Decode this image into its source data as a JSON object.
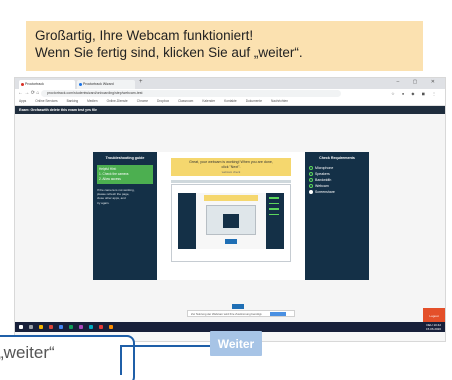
{
  "callout": {
    "line1": "Großartig, Ihre Webcam funktioniert!",
    "line2": "Wenn Sie fertig sind, klicken Sie auf „weiter“."
  },
  "browser": {
    "tab1": "Proctortrack",
    "tab2": "Proctortrack Wizard",
    "new_tab": "+",
    "window_controls": "– ▢ ✕",
    "url": "proctortrack.com/studentwizard/onboarding/step/webcam-test",
    "nav_icons": "← → ⟳ ⌂",
    "ext_icons": "☆ ● ◆ ◼ ⋮",
    "bookmarks": [
      "Apps",
      "Online Services",
      "Banking",
      "Medien",
      "Online-Dienste",
      "Chrome",
      "Dropbox",
      "Classroom",
      "Kalender",
      "Kontakte",
      "Dokumente",
      "Nachrichten"
    ]
  },
  "exam": {
    "bar_text": "Exam: Grofaswith delete this exam test yes file",
    "left_panel": {
      "title": "Troubleshooting guide",
      "green_lines": [
        "Helpful Hint:",
        "1. Check the camera",
        "2. Allow access"
      ],
      "text_lines": [
        "If the camera is not working,",
        "please refresh the page,",
        "close other apps, and",
        "try again."
      ]
    },
    "center": {
      "prompt": "Great, your webcam is working! When you are done,",
      "prompt2": "click \"Next\".",
      "sub": "webcam check"
    },
    "right_panel": {
      "title": "Check Requirements",
      "items": [
        {
          "label": "Microphone",
          "done": true
        },
        {
          "label": "Speakers",
          "done": true
        },
        {
          "label": "Bandwidth",
          "done": true
        },
        {
          "label": "Webcam",
          "done": true
        },
        {
          "label": "Screenshare",
          "done": false
        }
      ]
    },
    "bottom_bar": "Zur Nutzung der Webcam wird Ihre Zustimmung benötigt.",
    "orange_button": "Logout"
  },
  "taskbar": {
    "tray_line1": "DEU  10:42",
    "tray_line2": "15.06.2020"
  },
  "zoom": {
    "label": "„weiter“",
    "button": "Weiter"
  },
  "colors": {
    "callout_bg": "#fbe1b0",
    "panel": "#143047",
    "accent_green": "#4caf50",
    "button_blue": "#a7c4e6",
    "connector": "#1f5fa8"
  }
}
